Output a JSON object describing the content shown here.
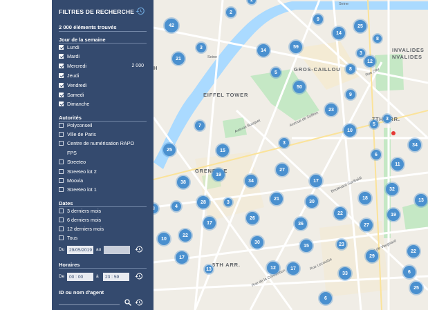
{
  "filters": {
    "title": "FILTRES DE RECHERCHE",
    "found": "2 000 éléments trouvés",
    "weekday": {
      "title": "Jour de la semaine",
      "count_label": "2 000",
      "items": [
        {
          "label": "Lundi",
          "checked": true
        },
        {
          "label": "Mardi",
          "checked": true
        },
        {
          "label": "Mercredi",
          "checked": true
        },
        {
          "label": "Jeudi",
          "checked": true
        },
        {
          "label": "Vendredi",
          "checked": true
        },
        {
          "label": "Samedi",
          "checked": true
        },
        {
          "label": "Dimanche",
          "checked": true
        }
      ]
    },
    "authorities": {
      "title": "Autorités",
      "items": [
        {
          "label": "Polyconseil",
          "checked": false
        },
        {
          "label": "Ville de Paris",
          "checked": false
        },
        {
          "label": "Centre de numérisation RAPO",
          "checked": false
        },
        {
          "label": "FPS",
          "checked": null
        },
        {
          "label": "Streeteo",
          "checked": false
        },
        {
          "label": "Streeteo lot 2",
          "checked": false
        },
        {
          "label": "Moovia",
          "checked": false
        },
        {
          "label": "Streeteo lot 1",
          "checked": false
        }
      ]
    },
    "dates": {
      "title": "Dates",
      "items": [
        {
          "label": "3 derniers mois",
          "checked": false
        },
        {
          "label": "6 derniers mois",
          "checked": false
        },
        {
          "label": "12 derniers mois",
          "checked": false
        },
        {
          "label": "Tous",
          "checked": false
        }
      ],
      "from_label": "Du",
      "from_value": "29/05/2019",
      "to_label": "au",
      "to_value": ""
    },
    "hours": {
      "title": "Horaires",
      "from_label": "De",
      "from_value": "00 : 00",
      "to_label": "à",
      "to_value": "23 : 59"
    },
    "agent": {
      "title": "ID ou nom d'agent",
      "value": ""
    }
  },
  "map": {
    "labels": [
      "EIFFEL TOWER",
      "GROS-CAILLOU",
      "7TH ARR.",
      "INVALIDES",
      "NVALIDES",
      "GRENELLE",
      "5TH ARR.",
      "Seine",
      "Seine",
      "H",
      "Avenue Bosquet",
      "Avenue de Suffren",
      "Rue de la Convention",
      "Rue Lecourbe",
      "Rue de Vaugirard",
      "Boulevard Garibaldi",
      "Rue Cler"
    ],
    "clusters": [
      {
        "n": "2"
      },
      {
        "n": "2"
      },
      {
        "n": "42"
      },
      {
        "n": "9"
      },
      {
        "n": "25"
      },
      {
        "n": "14"
      },
      {
        "n": "3"
      },
      {
        "n": "8"
      },
      {
        "n": "3"
      },
      {
        "n": "14"
      },
      {
        "n": "59"
      },
      {
        "n": "12"
      },
      {
        "n": "21"
      },
      {
        "n": "8"
      },
      {
        "n": "5"
      },
      {
        "n": "50"
      },
      {
        "n": "9"
      },
      {
        "n": "23"
      },
      {
        "n": "3"
      },
      {
        "n": "7"
      },
      {
        "n": "10"
      },
      {
        "n": "5"
      },
      {
        "n": "25"
      },
      {
        "n": "15"
      },
      {
        "n": "3"
      },
      {
        "n": "6"
      },
      {
        "n": "34"
      },
      {
        "n": "11"
      },
      {
        "n": "27"
      },
      {
        "n": "19"
      },
      {
        "n": "38"
      },
      {
        "n": "17"
      },
      {
        "n": "34"
      },
      {
        "n": "32"
      },
      {
        "n": "3"
      },
      {
        "n": "4"
      },
      {
        "n": "28"
      },
      {
        "n": "3"
      },
      {
        "n": "21"
      },
      {
        "n": "30"
      },
      {
        "n": "18"
      },
      {
        "n": "13"
      },
      {
        "n": "22"
      },
      {
        "n": "19"
      },
      {
        "n": "17"
      },
      {
        "n": "26"
      },
      {
        "n": "36"
      },
      {
        "n": "27"
      },
      {
        "n": "10"
      },
      {
        "n": "22"
      },
      {
        "n": "30"
      },
      {
        "n": "15"
      },
      {
        "n": "23"
      },
      {
        "n": "22"
      },
      {
        "n": "29"
      },
      {
        "n": "17"
      },
      {
        "n": "12"
      },
      {
        "n": "17"
      },
      {
        "n": "33"
      },
      {
        "n": "6"
      },
      {
        "n": "13"
      },
      {
        "n": "25"
      },
      {
        "n": "6"
      }
    ]
  }
}
